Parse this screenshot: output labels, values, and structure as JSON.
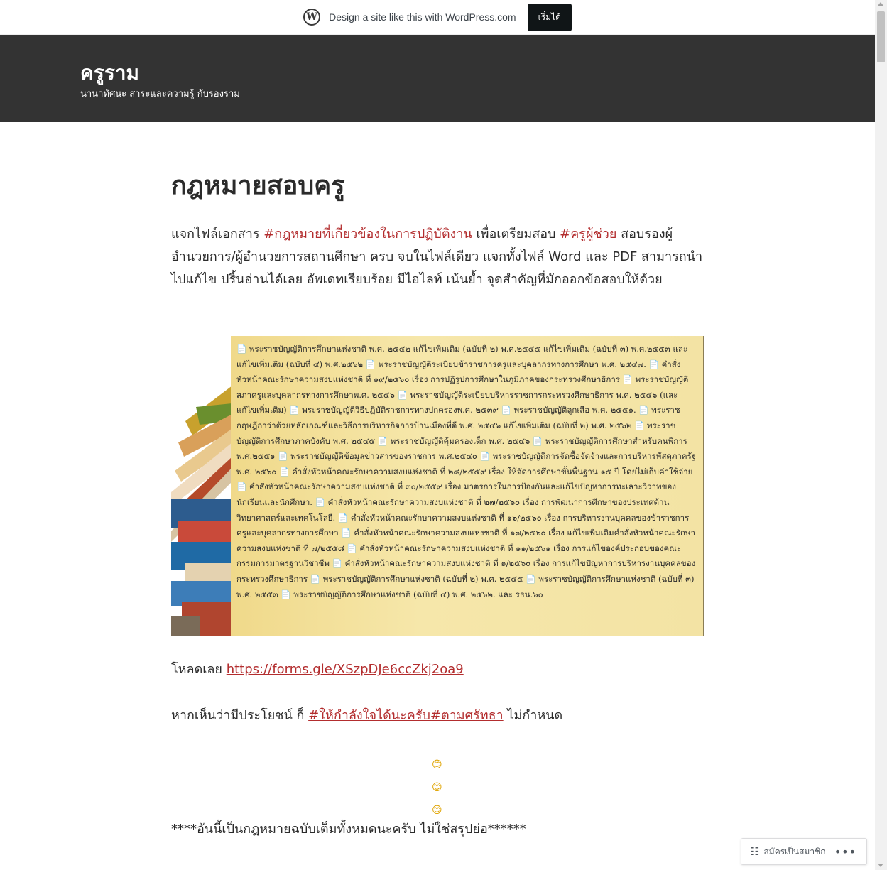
{
  "promo": {
    "logo_letter": "W",
    "text": "Design a site like this with WordPress.com",
    "button": "เริ่มได้"
  },
  "header": {
    "title": "ครูราม",
    "description": "นานาทัศนะ สาระและความรู้ กับรองราม"
  },
  "post": {
    "title": "กฎหมายสอบครู",
    "intro_1": "แจกไฟล์เอกสาร ",
    "tag_1": "#กฎหมายที่เกี่ยวข้องในการปฏิบัติงาน",
    "intro_2": " เพื่อเตรียมสอบ ",
    "tag_2": "#ครูผู้ช่วย",
    "intro_3": " สอบรองผู้อำนวยการ/ผู้อำนวยการสถานศึกษา ครบ จบในไฟล์เดียว แจกทั้งไฟล์ Word และ PDF สามารถนำไปแก้ไข ปริ้นอ่านได้เลย อัพเดทเรียบร้อย มีไฮไลท์ เน้นย้ำ จุดสำคัญที่มักออกข้อสอบให้ด้วย",
    "image_text": "📄 พระราชบัญญัติการศึกษาแห่งชาติ พ.ศ. ๒๕๔๒ แก้ไขเพิ่มเติม (ฉบับที่ ๒) พ.ศ.๒๕๔๕ แก้ไขเพิ่มเติม (ฉบับที่ ๓) พ.ศ.๒๕๕๓ และแก้ไขเพิ่มเติม (ฉบับที่ ๔) พ.ศ.๒๕๖๒ 📄 พระราชบัญญัติระเบียบข้าราชการครูและบุคลากรทางการศึกษา พ.ศ. ๒๕๔๗. 📄 คำสั่งหัวหน้าคณะรักษาความสงบแห่งชาติ ที่ ๑๙/๒๕๖๐ เรื่อง การปฏิรูปการศึกษาในภูมิภาคของกระทรวงศึกษาธิการ 📄 พระราชบัญญัติสภาครูและบุคลากรทางการศึกษาพ.ศ. ๒๕๔๖ 📄 พระราชบัญญัติระเบียบบริหารราชการกระทรวงศึกษาธิการ พ.ศ. ๒๕๔๖ (และแก้ไขเพิ่มเติม) 📄 พระราชบัญญัติวิธีปฏิบัติราชการทางปกครองพ.ศ. ๒๕๓๙ 📄 พระราชบัญญัติลูกเสือ พ.ศ. ๒๕๕๑. 📄 พระราชกฤษฎีกาว่าด้วยหลักเกณฑ์และวิธีการบริหารกิจการบ้านเมืองที่ดี พ.ศ. ๒๕๔๖ แก้ไขเพิ่มเติม (ฉบับที่ ๒) พ.ศ. ๒๕๖๒ 📄 พระราชบัญญัติการศึกษาภาคบังคับ พ.ศ. ๒๕๔๕ 📄 พระราชบัญญัติคุ้มครองเด็ก พ.ศ. ๒๕๔๖ 📄 พระราชบัญญัติการศึกษาสำหรับคนพิการ พ.ศ.๒๕๕๑ 📄 พระราชบัญญัติข้อมูลข่าวสารของราชการ พ.ศ.๒๕๔๐ 📄 พระราชบัญญัติการจัดซื้อจัดจ้างและการบริหารพัสดุภาครัฐ พ.ศ. ๒๕๖๐ 📄 คำสั่งหัวหน้าคณะรักษาความสงบแห่งชาติ ที่ ๒๘/๒๕๕๙ เรื่อง ให้จัดการศึกษาขั้นพื้นฐาน ๑๕ ปี โดยไม่เก็บค่าใช้จ่าย 📄 คำสั่งหัวหน้าคณะรักษาความสงบแห่งชาติ ที่ ๓๐/๒๕๕๙ เรื่อง มาตรการในการป้องกันและแก้ไขปัญหาการทะเลาะวิวาทของนักเรียนและนักศึกษา. 📄 คำสั่งหัวหน้าคณะรักษาความสงบแห่งชาติ ที่ ๒๗/๒๕๖๐ เรื่อง การพัฒนาการศึกษาของประเทศด้านวิทยาศาสตร์และเทคโนโลยี. 📄 คำสั่งหัวหน้าคณะรักษาความสงบแห่งชาติ ที่ ๑๖/๒๕๖๐ เรื่อง การบริหารงานบุคคลของข้าราชการครูและบุคลากรทางการศึกษา 📄 คำสั่งหัวหน้าคณะรักษาความสงบแห่งชาติ ที่ ๑๗/๒๕๖๐ เรื่อง แก้ไขเพิ่มเติมคำสั่งหัวหน้าคณะรักษาความสงบแห่งชาติ ที่ ๗/๒๕๕๘ 📄 คำสั่งหัวหน้าคณะรักษาความสงบแห่งชาติ ที่ ๑๑/๒๕๖๑ เรื่อง การแก้ไของค์ประกอบของคณะกรรมการมาตรฐานวิชาชีพ 📄 คำสั่งหัวหน้าคณะรักษาความสงบแห่งชาติ ที่ ๑/๒๕๖๐ เรื่อง การแก้ไขปัญหาการบริหารงานบุคคลของกระทรวงศึกษาธิการ 📄 พระราชบัญญัติการศึกษาแห่งชาติ (ฉบับที่ ๒) พ.ศ. ๒๕๔๕ 📄 พระราชบัญญัติการศึกษาแห่งชาติ (ฉบับที่ ๓) พ.ศ. ๒๕๕๓ 📄 พระราชบัญญัติการศึกษาแห่งชาติ (ฉบับที่ ๔) พ.ศ. ๒๕๖๒. และ รธน.๖๐",
    "download_label": "โหลดเลย ",
    "download_link": "https://forms.gle/XSzpDJe6ccZkj2oa9",
    "support_1": "หากเห็นว่ามีประโยชน์ ก็ ",
    "support_tag": "#ให้กำลังใจได้นะครับ#ตามศรัทธา",
    "support_2": " ไม่กำหนด",
    "emoji": "😊",
    "notice": "****อันนี้เป็นกฎหมายฉบับเต็มทั้งหมดนะครับ ไม่ใช่สรุปย่อ******"
  },
  "subscribe": {
    "icon": "reader-icon",
    "label": "สมัครเป็นสมาชิก",
    "more": "•••"
  }
}
